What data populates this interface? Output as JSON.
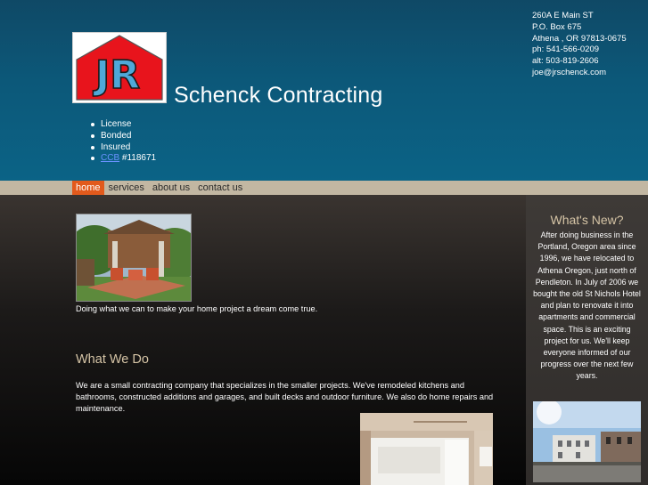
{
  "header": {
    "logo_text": "JR",
    "site_title": "Schenck Contracting",
    "features": [
      {
        "text": "License"
      },
      {
        "text": "Bonded"
      },
      {
        "text": "Insured"
      },
      {
        "link": "CCB",
        "text": " #118671"
      }
    ],
    "contact": {
      "street": "260A E Main ST",
      "po_box": "P.O. Box 675",
      "city": "Athena , OR 97813-0675",
      "phone": "ph: 541-566-0209",
      "alt_phone": "alt: 503-819-2606",
      "email": "joe@jrschenck.com"
    }
  },
  "nav": {
    "items": [
      "home",
      "services",
      "about us",
      "contact us"
    ],
    "active": "home"
  },
  "main": {
    "hero_caption": "Doing what we can to make your home project a dream come true.",
    "what_we_do": {
      "heading": "What We Do",
      "text": "We are a small contracting company that specializes in the smaller projects.  We've remodeled kitchens and bathrooms, constructed additions and garages, and built decks and outdoor furniture. We also do home repairs and maintenance."
    }
  },
  "sidebar": {
    "heading": "What's New?",
    "text": "After doing business in the Portland, Oregon area since 1996, we have relocated to Athena Oregon, just north of Pendleton.  In July of 2006 we bought the old St Nichols Hotel and plan to renovate it into apartments and commercial space.  This is an exciting project for us. We'll keep everyone informed of our progress over the next few years."
  },
  "colors": {
    "header_blue": "#0c5879",
    "nav_bar": "#c2b7a2",
    "nav_active": "#e25a1c",
    "heading_tan": "#d5c4a6",
    "logo_red": "#e8141c",
    "logo_letters": "#4fa8d8"
  }
}
